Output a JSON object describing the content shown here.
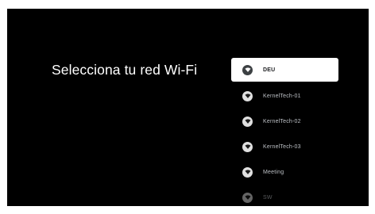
{
  "title": "Selecciona tu red Wi-Fi",
  "networks": [
    {
      "label": "DEU",
      "icon": "wifi-lock-icon",
      "selected": true
    },
    {
      "label": "KernelTech-01",
      "icon": "wifi-lock-icon",
      "selected": false
    },
    {
      "label": "KernelTech-02",
      "icon": "wifi-lock-icon",
      "selected": false
    },
    {
      "label": "KernelTech-03",
      "icon": "wifi-lock-icon",
      "selected": false
    },
    {
      "label": "Meeting",
      "icon": "wifi-lock-icon",
      "selected": false
    },
    {
      "label": "SW",
      "icon": "wifi-lock-icon",
      "selected": false
    }
  ],
  "colors": {
    "background": "#000000",
    "selected_background": "#ffffff",
    "text": "#ffffff"
  }
}
